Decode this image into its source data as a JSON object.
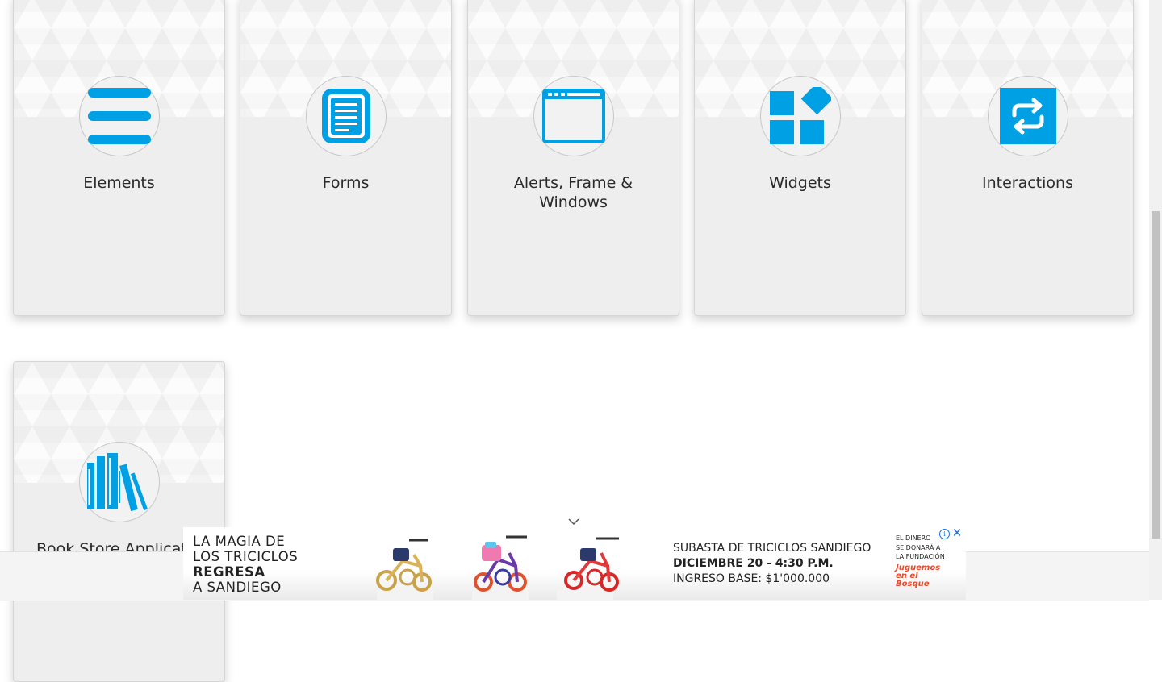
{
  "cards": [
    {
      "title": "Elements",
      "icon": "hamburger-menu-icon"
    },
    {
      "title": "Forms",
      "icon": "document-icon"
    },
    {
      "title": "Alerts, Frame & Windows",
      "icon": "browser-window-icon"
    },
    {
      "title": "Widgets",
      "icon": "widgets-icon"
    },
    {
      "title": "Interactions",
      "icon": "repeat-arrows-icon"
    },
    {
      "title": "Book Store Applicati",
      "icon": "books-icon"
    }
  ],
  "ad": {
    "left_lines": [
      "LA MAGIA DE",
      "LOS TRICICLOS",
      "REGRESA",
      "A SANDIEGO"
    ],
    "mid_lines": [
      "SUBASTA DE TRICICLOS SANDIEGO",
      "DICIEMBRE 20 - 4:30 P.M.",
      "INGRESO BASE: $1'000.000"
    ],
    "right_lines": [
      "EL DINERO",
      "SE DONARÁ A",
      "LA FUNDACIÓN"
    ],
    "foundation": [
      "Juguemos",
      "en el",
      "Bosque"
    ],
    "close_label": "✕",
    "info_label": "i"
  },
  "colors": {
    "accent": "#00a0e4",
    "card_bg": "#eeeeee",
    "ad_red": "#e84a2b"
  }
}
